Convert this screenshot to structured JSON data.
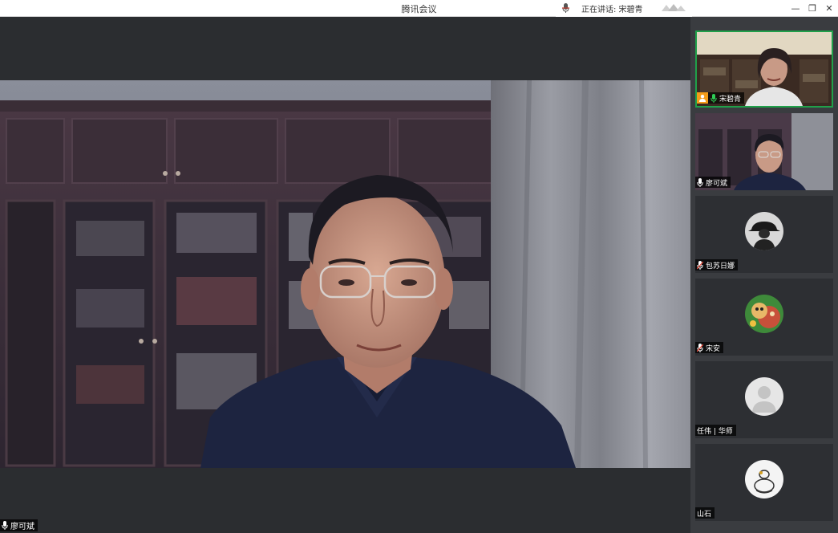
{
  "window": {
    "title": "腾讯会议",
    "speaking_label": "正在讲话: 宋碧青",
    "controls": {
      "minimize": "—",
      "restore": "❐",
      "close": "✕"
    }
  },
  "main_video": {
    "participant_name": "廖可斌",
    "mic_state": "unmuted"
  },
  "participants": [
    {
      "name": "宋碧青",
      "mic": "speaking",
      "host": true,
      "video": true
    },
    {
      "name": "廖可斌",
      "mic": "unmuted",
      "host": false,
      "video": true
    },
    {
      "name": "包苏日娜",
      "mic": "muted",
      "host": false,
      "video": false
    },
    {
      "name": "宋安",
      "mic": "muted",
      "host": false,
      "video": false
    },
    {
      "name": "任伟 | 华师",
      "mic": "none",
      "host": false,
      "video": false
    },
    {
      "name": "山石",
      "mic": "none",
      "host": false,
      "video": false
    }
  ],
  "colors": {
    "background": "#2b2d30",
    "sidebar": "#3a3c40",
    "active_border": "#20a04a",
    "host_badge": "#f39c19"
  }
}
